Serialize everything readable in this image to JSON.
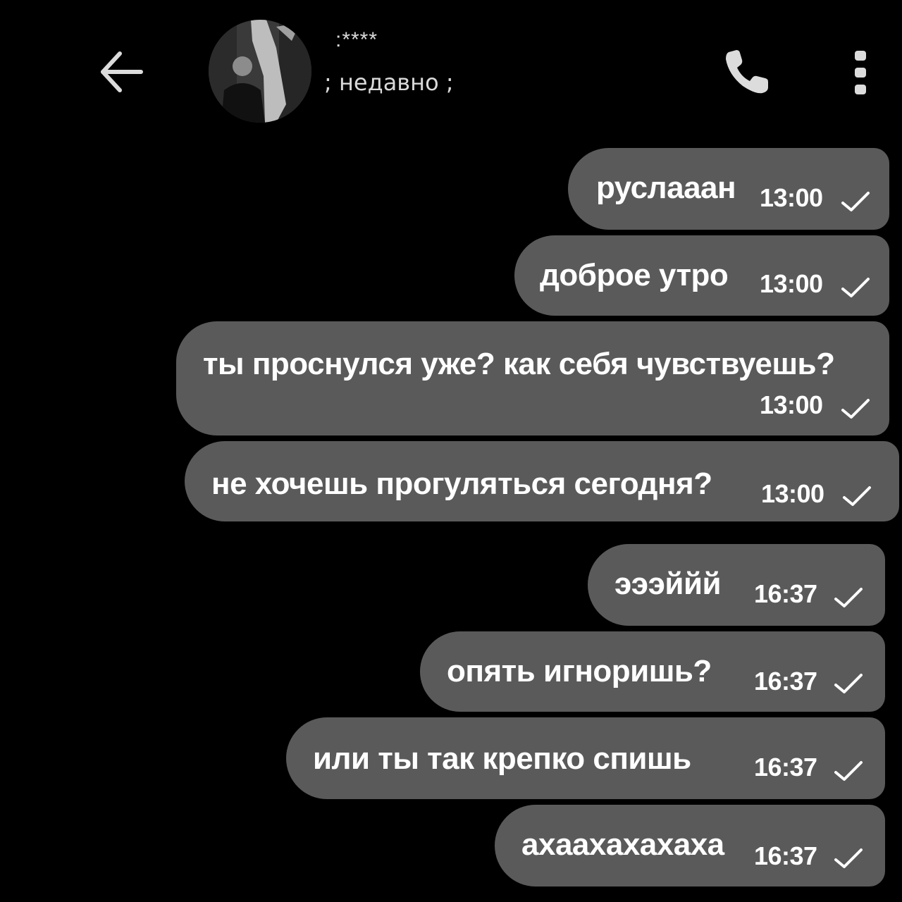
{
  "header": {
    "contact_name": ":****",
    "status": "; недавно ;",
    "back_icon": "arrow-left-icon",
    "call_icon": "phone-icon",
    "menu_icon": "more-vertical-icon"
  },
  "colors": {
    "background": "#000000",
    "bubble": "#5a5a5a",
    "text": "#ffffff",
    "header_text": "#d9d9d9"
  },
  "messages": [
    {
      "text": "руслааан",
      "time": "13:00",
      "status_icon": "check-icon"
    },
    {
      "text": "доброе утро",
      "time": "13:00",
      "status_icon": "check-icon"
    },
    {
      "text": "ты проснулся уже? как себя чувствуешь?",
      "time": "13:00",
      "status_icon": "check-icon"
    },
    {
      "text": "не хочешь прогуляться сегодня?",
      "time": "13:00",
      "status_icon": "check-icon"
    },
    {
      "text": "эээййй",
      "time": "16:37",
      "status_icon": "check-icon"
    },
    {
      "text": "опять игноришь?",
      "time": "16:37",
      "status_icon": "check-icon"
    },
    {
      "text": "или ты так крепко спишь",
      "time": "16:37",
      "status_icon": "check-icon"
    },
    {
      "text": "ахаахахахаха",
      "time": "16:37",
      "status_icon": "check-icon"
    }
  ]
}
